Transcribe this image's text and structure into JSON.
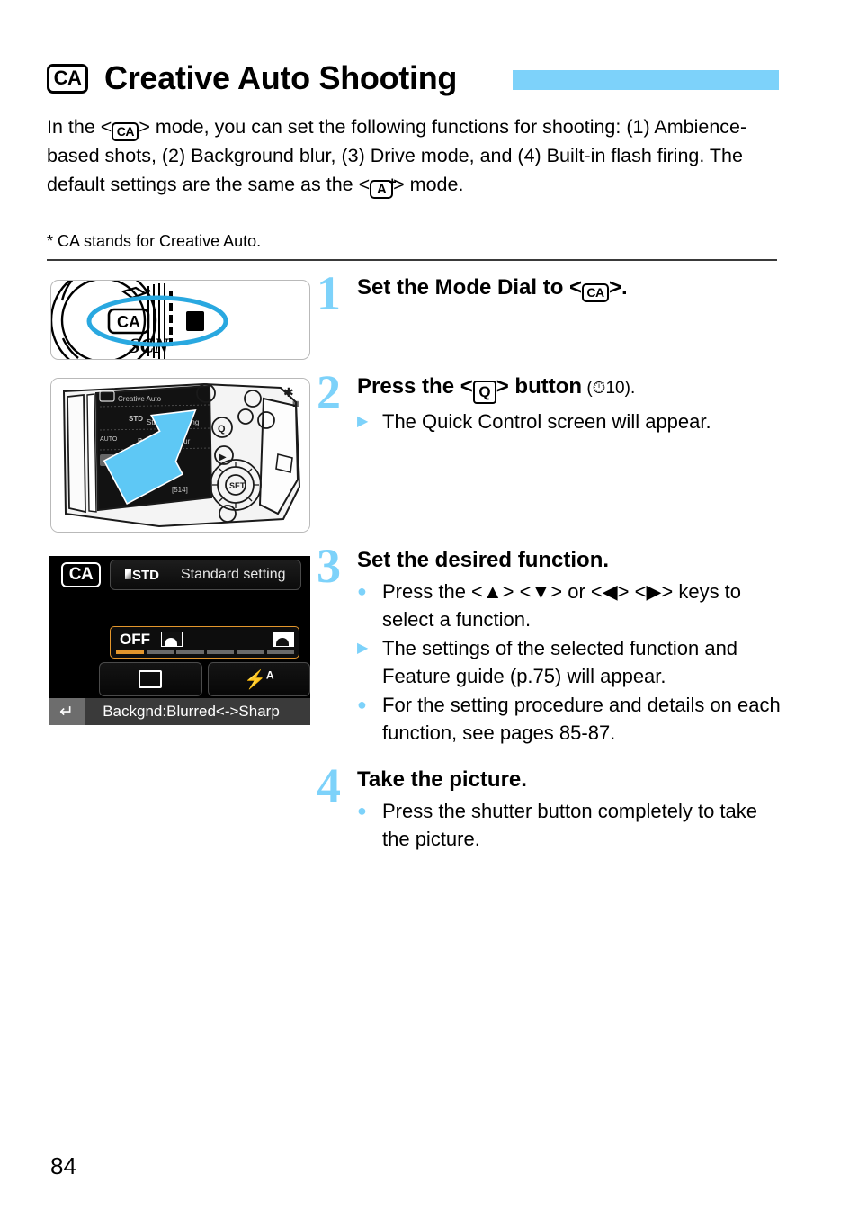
{
  "page": {
    "number": "84",
    "accent_color": "#7dd2fa",
    "highlight_color": "#e3962c"
  },
  "title": {
    "badge": "CA",
    "text": "Creative Auto Shooting"
  },
  "intro": {
    "part1": "In the <",
    "badge1": "CA",
    "part2": "> mode, you can set the following functions for shooting: (1) Ambience-based shots, (2) Background blur, (3) Drive mode, and (4) Built-in flash firing. The default settings are the same as the <",
    "badge2": "A",
    "badge2_sup": "+",
    "part3": "> mode.",
    "footnote": "* CA stands for Creative Auto."
  },
  "steps": [
    {
      "number": "1",
      "heading_pre": "Set the Mode Dial to <",
      "heading_badge": "CA",
      "heading_post": ">.",
      "bullets": []
    },
    {
      "number": "2",
      "heading_pre": "Press the <",
      "heading_badge": "Q",
      "heading_post": "> button",
      "heading_light": " (⏱10).",
      "bullets": [
        {
          "mark": "triangle",
          "text": "The Quick Control screen will appear."
        }
      ]
    },
    {
      "number": "3",
      "heading_pre": "Set the desired function.",
      "bullets": [
        {
          "mark": "dot",
          "text": "Press the <▲> <▼> or <◀> <▶> keys to select a function."
        },
        {
          "mark": "triangle",
          "text": "The settings of the selected function and Feature guide (p.75) will appear."
        },
        {
          "mark": "dot",
          "text": "For the setting procedure and details on each function, see pages 85-87."
        }
      ]
    },
    {
      "number": "4",
      "heading_pre": "Take the picture.",
      "bullets": [
        {
          "mark": "dot",
          "text": "Press the shutter button completely to take the picture."
        }
      ]
    }
  ],
  "figures": {
    "dial": {
      "name": "mode-dial-photo",
      "labels": [
        "CA",
        "SCN"
      ],
      "highlight": "CA"
    },
    "camera": {
      "name": "camera-back-photo",
      "screen_texts": [
        "Creative Auto",
        "Standard setting",
        "Background blur",
        "[514]"
      ],
      "callout": "Q button"
    },
    "lcd": {
      "mode_badge": "CA",
      "ambience_icon": "STD",
      "ambience_label": "Standard setting",
      "blur_off_label": "OFF",
      "blur_ticks": 6,
      "blur_active_tick": 0,
      "drive_mode_icon": "single-shot",
      "flash_icon": "flash-auto",
      "flash_label_sup": "A",
      "back_icon": "↵",
      "feature_guide": "Backgnd:Blurred<->Sharp"
    }
  }
}
